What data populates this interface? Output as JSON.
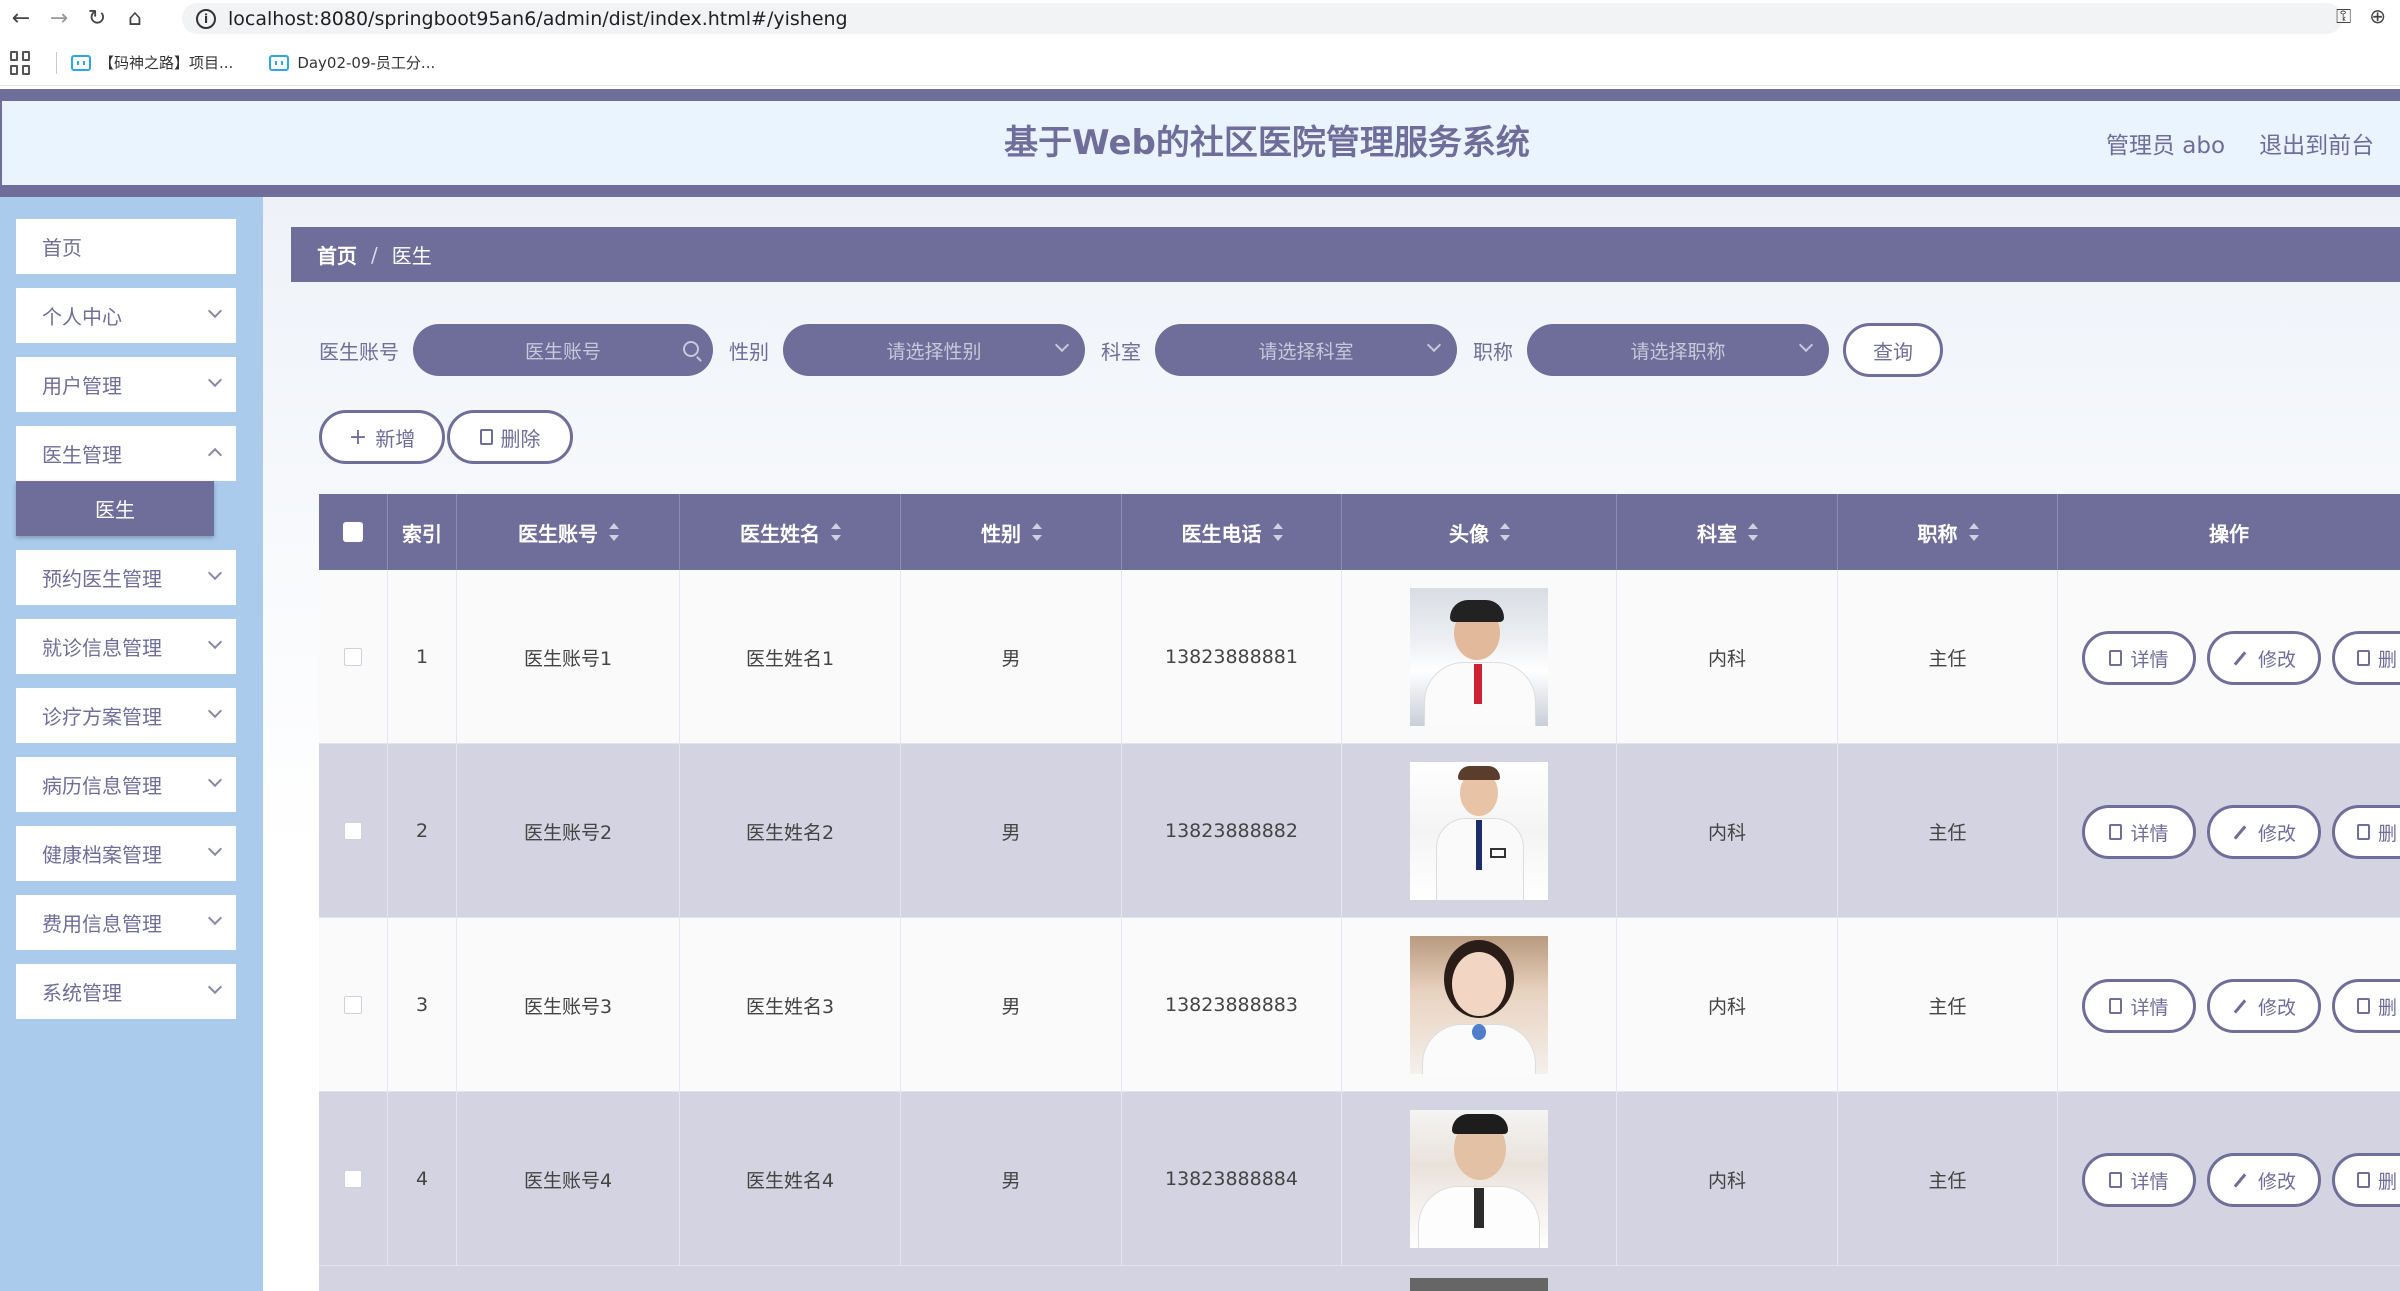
{
  "browser": {
    "url": "localhost:8080/springboot95an6/admin/dist/index.html#/yisheng",
    "bookmarks": [
      "【码神之路】项目...",
      "Day02-09-员工分..."
    ]
  },
  "header": {
    "title": "基于Web的社区医院管理服务系统",
    "admin_label": "管理员 abo",
    "logout_label": "退出到前台",
    "overflow_label": "退"
  },
  "sidebar": {
    "items": [
      {
        "label": "首页"
      },
      {
        "label": "个人中心"
      },
      {
        "label": "用户管理"
      },
      {
        "label": "医生管理"
      },
      {
        "label": "医生"
      },
      {
        "label": "预约医生管理"
      },
      {
        "label": "就诊信息管理"
      },
      {
        "label": "诊疗方案管理"
      },
      {
        "label": "病历信息管理"
      },
      {
        "label": "健康档案管理"
      },
      {
        "label": "费用信息管理"
      },
      {
        "label": "系统管理"
      }
    ]
  },
  "breadcrumb": {
    "home": "首页",
    "separator": "/",
    "current": "医生"
  },
  "search": {
    "account_label": "医生账号",
    "account_placeholder": "医生账号",
    "gender_label": "性别",
    "gender_placeholder": "请选择性别",
    "dept_label": "科室",
    "dept_placeholder": "请选择科室",
    "title_label": "职称",
    "title_placeholder": "请选择职称",
    "query_button": "查询"
  },
  "actions": {
    "add": "新增",
    "delete": "删除"
  },
  "table": {
    "headers": [
      "索引",
      "医生账号",
      "医生姓名",
      "性别",
      "医生电话",
      "头像",
      "科室",
      "职称",
      "操作"
    ],
    "rows": [
      {
        "index": "1",
        "account": "医生账号1",
        "name": "医生姓名1",
        "gender": "男",
        "phone": "13823888881",
        "dept": "内科",
        "title": "主任"
      },
      {
        "index": "2",
        "account": "医生账号2",
        "name": "医生姓名2",
        "gender": "男",
        "phone": "13823888882",
        "dept": "内科",
        "title": "主任"
      },
      {
        "index": "3",
        "account": "医生账号3",
        "name": "医生姓名3",
        "gender": "男",
        "phone": "13823888883",
        "dept": "内科",
        "title": "主任"
      },
      {
        "index": "4",
        "account": "医生账号4",
        "name": "医生姓名4",
        "gender": "男",
        "phone": "13823888884",
        "dept": "内科",
        "title": "主任"
      }
    ],
    "op_buttons": {
      "detail": "详情",
      "edit": "修改",
      "delete_partial": "删"
    }
  },
  "colors": {
    "primary": "#6f6d99",
    "sidebar": "#aacbec",
    "header_bg": "#eaf4ff",
    "row_alt": "#d3d3e1"
  }
}
